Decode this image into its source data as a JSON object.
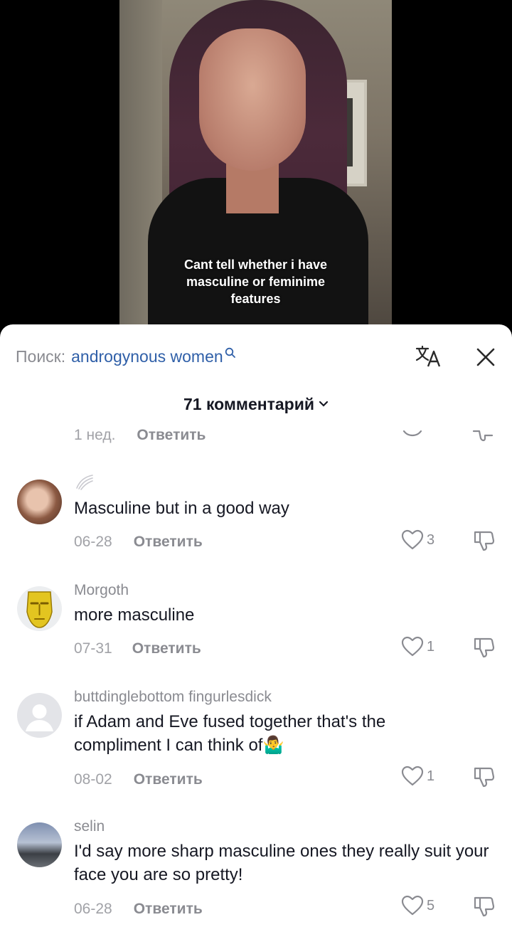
{
  "video": {
    "caption_lines": [
      "Cant tell whether i have",
      "masculine or feminime",
      "features"
    ]
  },
  "sheet": {
    "search_prefix": "Поиск:",
    "search_term": "androgynous women",
    "comment_count": "71 комментарий",
    "reply_label": "Ответить"
  },
  "partial_row": {
    "date": "1 нед."
  },
  "comments": [
    {
      "username": "",
      "text": "Masculine but in a good way",
      "date": "06-28",
      "likes": "3",
      "avatar": "photo-avatar-woman"
    },
    {
      "username": "Morgoth",
      "text": "more masculine",
      "date": "07-31",
      "likes": "1",
      "avatar": "gold-mask-avatar"
    },
    {
      "username": "buttdinglebottom fingurlesdick",
      "text": "if Adam and Eve fused together that's the compliment I can think of🤷‍♂️",
      "date": "08-02",
      "likes": "1",
      "avatar": "default-avatar"
    },
    {
      "username": "selin",
      "text": "I'd say more sharp masculine ones they really suit your face you are so pretty!",
      "date": "06-28",
      "likes": "5",
      "avatar": "landscape-avatar"
    }
  ],
  "colors": {
    "link_blue": "#2f5fa8",
    "muted_gray": "#8a8b91",
    "text_dark": "#161823"
  }
}
